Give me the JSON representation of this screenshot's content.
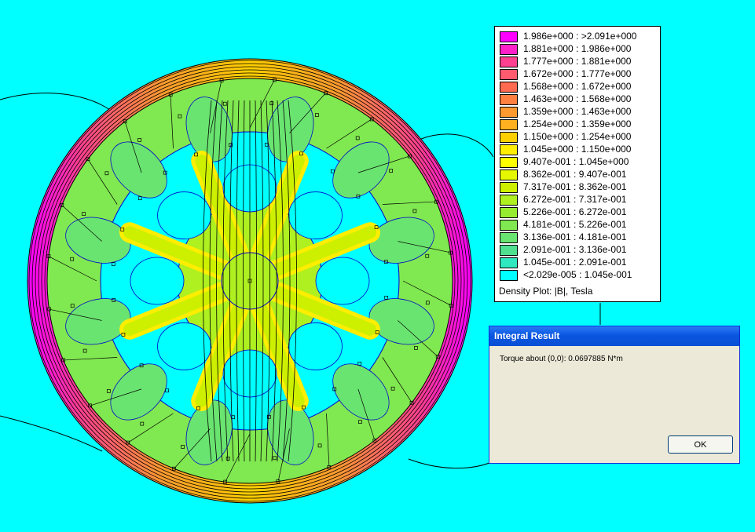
{
  "legend": {
    "entries": [
      {
        "label": "1.986e+000 : >2.091e+000",
        "color": "#ff00ff"
      },
      {
        "label": "1.881e+000 : 1.986e+000",
        "color": "#ff20c8"
      },
      {
        "label": "1.777e+000 : 1.881e+000",
        "color": "#ff4090"
      },
      {
        "label": "1.672e+000 : 1.777e+000",
        "color": "#ff5a6e"
      },
      {
        "label": "1.568e+000 : 1.672e+000",
        "color": "#ff6a50"
      },
      {
        "label": "1.463e+000 : 1.568e+000",
        "color": "#ff8040"
      },
      {
        "label": "1.359e+000 : 1.463e+000",
        "color": "#ff9a30"
      },
      {
        "label": "1.254e+000 : 1.359e+000",
        "color": "#ffb020"
      },
      {
        "label": "1.150e+000 : 1.254e+000",
        "color": "#ffd000"
      },
      {
        "label": "1.045e+000 : 1.150e+000",
        "color": "#ffee00"
      },
      {
        "label": "9.407e-001 : 1.045e+000",
        "color": "#ffff00"
      },
      {
        "label": "8.362e-001 : 9.407e-001",
        "color": "#e6f800"
      },
      {
        "label": "7.317e-001 : 8.362e-001",
        "color": "#ccf000"
      },
      {
        "label": "6.272e-001 : 7.317e-001",
        "color": "#aef020"
      },
      {
        "label": "5.226e-001 : 6.272e-001",
        "color": "#96ec30"
      },
      {
        "label": "4.181e-001 : 5.226e-001",
        "color": "#80e850"
      },
      {
        "label": "3.136e-001 : 4.181e-001",
        "color": "#6ae470"
      },
      {
        "label": "2.091e-001 : 3.136e-001",
        "color": "#50e090"
      },
      {
        "label": "1.045e-001 : 2.091e-001",
        "color": "#30e8c0"
      },
      {
        "label": "<2.029e-005 : 1.045e-001",
        "color": "#00ffff"
      }
    ],
    "caption": "Density Plot: |B|, Tesla"
  },
  "dialog": {
    "title": "Integral Result",
    "message": "Torque about (0,0): 0.0697885 N*m",
    "ok_label": "OK"
  },
  "colors": {
    "background": "#00ffff",
    "ring_outer": "#ff00ff",
    "ring_inner": "#ff6a50",
    "stator": "#80e850",
    "rotor": "#aef020",
    "flux_lines": "#000000",
    "mesh_lines": "#0000cc"
  }
}
